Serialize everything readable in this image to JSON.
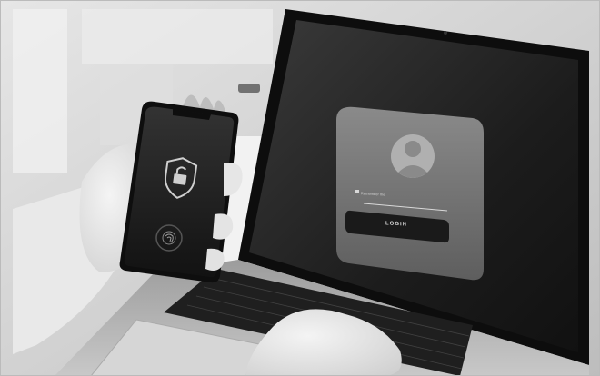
{
  "photo": {
    "subject": "hands holding a smartphone with a lock screen next to a laptop showing a login form",
    "tone": "grayscale"
  },
  "phone_screen": {
    "icons": [
      "shield-lock-icon",
      "fingerprint-icon"
    ]
  },
  "laptop_screen": {
    "login_card": {
      "avatar_icon": "user-silhouette-icon",
      "remember_label": "Remember me",
      "login_button_label": "LOGIN"
    }
  }
}
